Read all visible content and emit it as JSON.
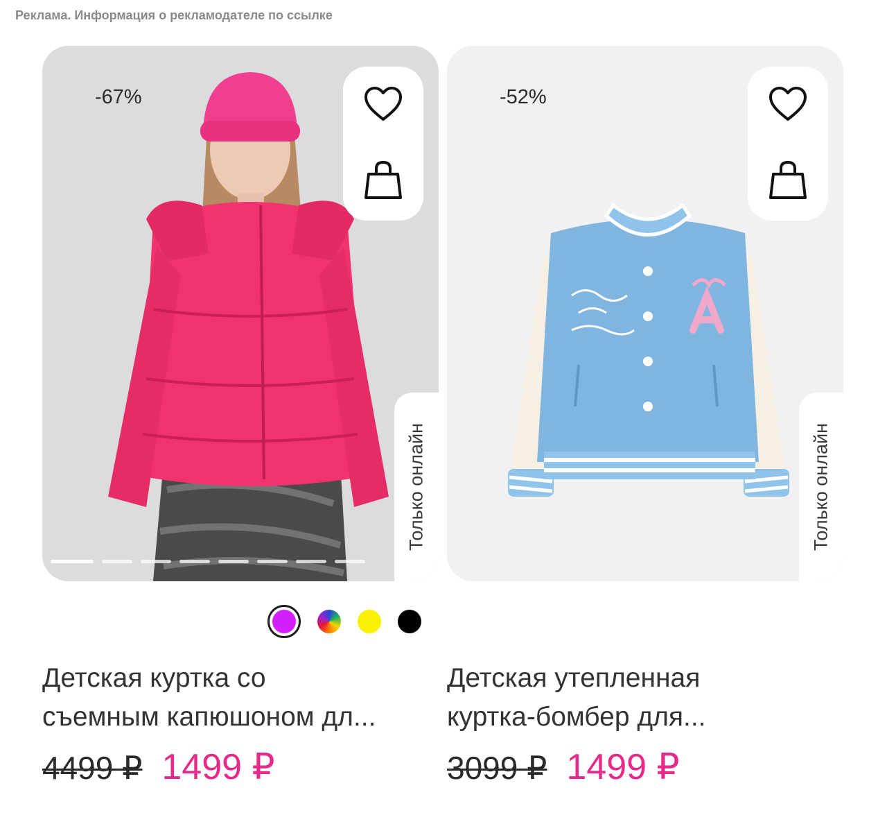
{
  "ad_notice": "Реклама. Информация о рекламодателе по ссылке",
  "products": [
    {
      "discount": "-67%",
      "badge": "Только онлайн",
      "title_line1": "Детская куртка со",
      "title_line2": "съемным капюшоном дл...",
      "old_price": "4499 ₽",
      "new_price": "1499 ₽",
      "slides": 8,
      "swatches": [
        {
          "color": "#d420ff",
          "selected": true
        },
        {
          "color": "multicolor",
          "selected": false
        },
        {
          "color": "#f7f000",
          "selected": false
        },
        {
          "color": "#000000",
          "selected": false
        }
      ]
    },
    {
      "discount": "-52%",
      "badge": "Только онлайн",
      "title_line1": "Детская утепленная",
      "title_line2": "куртка-бомбер для...",
      "old_price": "3099 ₽",
      "new_price": "1499 ₽"
    }
  ],
  "colors": {
    "price_accent": "#e62a8a",
    "jacket_pink": "#f0336e",
    "bomber_blue": "#7fb5de"
  }
}
